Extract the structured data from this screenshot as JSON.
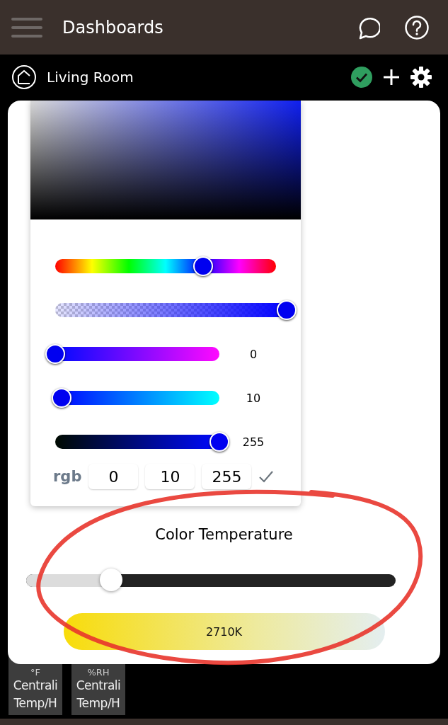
{
  "app_bar": {
    "title": "Dashboards"
  },
  "room_bar": {
    "title": "Living Room"
  },
  "tiles": [
    {
      "lines": [
        "°F",
        "Centrali",
        "Temp/H"
      ]
    },
    {
      "lines": [
        "%RH",
        "Centrali",
        "Temp/H"
      ]
    }
  ],
  "color_picker": {
    "sliders": [
      {
        "kind": "hue",
        "level": 0.67
      },
      {
        "kind": "alpha",
        "level": 1
      },
      {
        "kind": "red",
        "level": 0,
        "reading": "0"
      },
      {
        "kind": "green",
        "level": 0.04,
        "reading": "10"
      },
      {
        "kind": "blue",
        "level": 1,
        "reading": "255"
      }
    ],
    "mode": "rgb",
    "fields": [
      "0",
      "10",
      "255"
    ]
  },
  "color_temperature": {
    "title": "Color Temperature",
    "level": 0.23,
    "button": "2710K"
  }
}
